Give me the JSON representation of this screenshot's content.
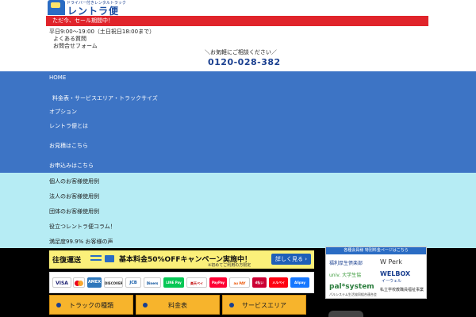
{
  "header": {
    "logo_tagline": "ドライバー付きレンタルトラック",
    "brand_name": "レントラ便",
    "sale_banner": "ただ今、セール期間中！",
    "hours": "平日9:00～19:00（土日祝日18:00まで）",
    "links": [
      "よくある質問",
      "お問合せフォーム"
    ],
    "phone_note": "＼お気軽にご相談ください／",
    "phone_number": "0120-028-382"
  },
  "nav_main": {
    "items": [
      "HOME",
      "料金表・サービスエリア・トラックサイズ",
      "オプション",
      "レントラ便とは",
      "お見積はこちら",
      "お申込みはこちら"
    ]
  },
  "nav_sub": {
    "items": [
      "個人のお客様使用例",
      "法人のお客様使用例",
      "団体のお客様使用例",
      "役立つレントラ便コラム！",
      "満足度99.9% お客様の声"
    ]
  },
  "campaign": {
    "roundtrip": "往復運送",
    "headline": "基本料金50%OFFキャンペーン実施中！",
    "note": "※初めてご利用の方限定",
    "more_button": "詳しく見る ›"
  },
  "payments": {
    "methods": [
      "VISA",
      "Mastercard",
      "AMEX",
      "DISCOVER",
      "JCB",
      "Diners",
      "LINE Pay",
      "楽天ペイ",
      "PayPay",
      "au PAY",
      "d払い",
      "メルペイ",
      "Alipay"
    ]
  },
  "bottom_buttons": [
    "トラックの種類",
    "料金表",
    "サービスエリア"
  ],
  "sidebar": {
    "title": "各種会員様 特別料金ページはこちら",
    "partners": {
      "fukuri": "福利厚生倶楽部",
      "perk": "W Perk",
      "univ": "univ. 大学生協",
      "welbox": "WELBOX",
      "welbox_sub": "イーウェル",
      "palsystem": "pal*system",
      "palsystem_sub": "パルシステム生活協同組合連合会",
      "shiritsu": "私立学校教職員福祉事業"
    }
  },
  "colors": {
    "nav_main_bg": "#3d74c5",
    "nav_sub_bg": "#b6ecf4",
    "sale_red": "#e0242b",
    "brand_blue": "#1a3f8f",
    "button_orange": "#f7b42c",
    "campaign_yellow": "#fbf07a"
  }
}
